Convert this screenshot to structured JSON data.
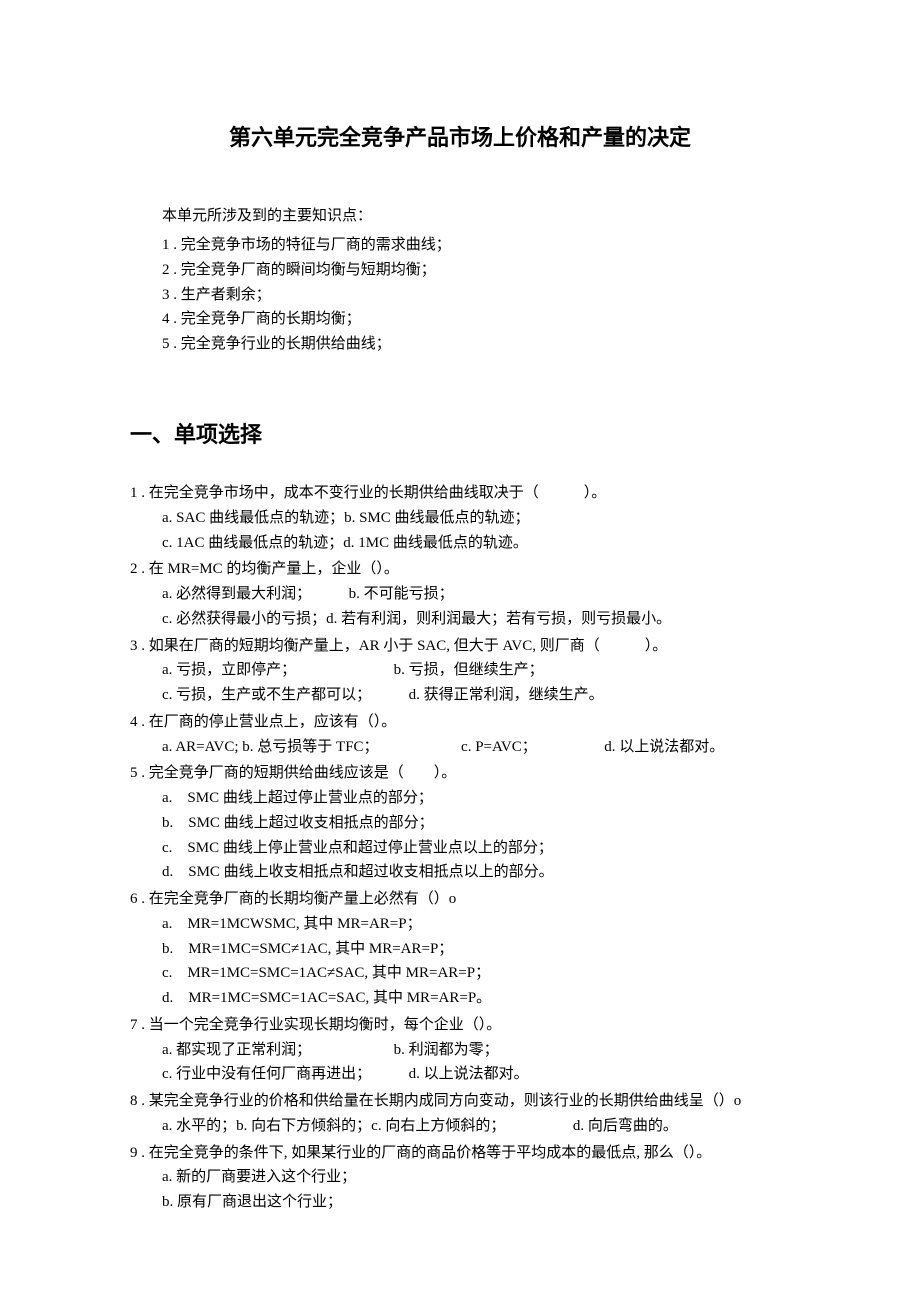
{
  "title": "第六单元完全竞争产品市场上价格和产量的决定",
  "knowledge": {
    "intro": "本单元所涉及到的主要知识点：",
    "items": [
      "1 . 完全竞争市场的特征与厂商的需求曲线；",
      "2 . 完全竞争厂商的瞬间均衡与短期均衡；",
      "3 . 生产者剩余；",
      "4 . 完全竞争厂商的长期均衡；",
      "5 . 完全竞争行业的长期供给曲线；"
    ]
  },
  "section_heading": "一、单项选择",
  "questions": [
    {
      "stem": "1 . 在完全竞争市场中，成本不变行业的长期供给曲线取决于（　　　）。",
      "lines": [
        "a. SAC 曲线最低点的轨迹；b. SMC 曲线最低点的轨迹；",
        "c. 1AC 曲线最低点的轨迹；d. 1MC 曲线最低点的轨迹。"
      ]
    },
    {
      "stem": "2 . 在 MR=MC 的均衡产量上，企业（）。",
      "lines": [
        "a. 必然得到最大利润；　　　b. 不可能亏损；",
        "c. 必然获得最小的亏损；d. 若有利润，则利润最大；若有亏损，则亏损最小。"
      ]
    },
    {
      "stem": "3 . 如果在厂商的短期均衡产量上，AR 小于 SAC, 但大于 AVC, 则厂商（　　　）。",
      "lines": [
        "a. 亏损，立即停产；　　　　　　　b. 亏损，但继续生产；",
        "c. 亏损，生产或不生产都可以；　　　d. 获得正常利润，继续生产。"
      ]
    },
    {
      "stem": "4 . 在厂商的停止营业点上，应该有（）。",
      "lines": [
        "a. AR=AVC; b. 总亏损等于 TFC；　　　　　　c. P=AVC；　　　　　d. 以上说法都对。"
      ]
    },
    {
      "stem": "5 . 完全竞争厂商的短期供给曲线应该是（　　）。",
      "lines": [
        "a.　SMC 曲线上超过停止营业点的部分；",
        "b.　SMC 曲线上超过收支相抵点的部分；",
        "c.　SMC 曲线上停止营业点和超过停止营业点以上的部分；",
        "d.　SMC 曲线上收支相抵点和超过收支相抵点以上的部分。"
      ]
    },
    {
      "stem": "6 . 在完全竞争厂商的长期均衡产量上必然有（）o",
      "lines": [
        "a.　MR=1MCWSMC, 其中 MR=AR=P；",
        "b.　MR=1MC=SMC≠1AC, 其中 MR=AR=P；",
        "c.　MR=1MC=SMC=1AC≠SAC, 其中 MR=AR=P；",
        "d.　MR=1MC=SMC=1AC=SAC, 其中 MR=AR=P。"
      ]
    },
    {
      "stem": "7 . 当一个完全竞争行业实现长期均衡时，每个企业（）。",
      "lines": [
        "a. 都实现了正常利润；　　　　　　b. 利润都为零；",
        "c. 行业中没有任何厂商再进出；　　　d. 以上说法都对。"
      ]
    },
    {
      "stem": "8 . 某完全竞争行业的价格和供给量在长期内成同方向变动，则该行业的长期供给曲线呈（）o",
      "lines": [
        "a. 水平的；b. 向右下方倾斜的；c. 向右上方倾斜的；　　　　　d. 向后弯曲的。"
      ]
    },
    {
      "stem": "9 . 在完全竞争的条件下, 如果某行业的厂商的商品价格等于平均成本的最低点, 那么（）。",
      "lines": [
        "a. 新的厂商要进入这个行业；",
        "b. 原有厂商退出这个行业；"
      ]
    }
  ]
}
